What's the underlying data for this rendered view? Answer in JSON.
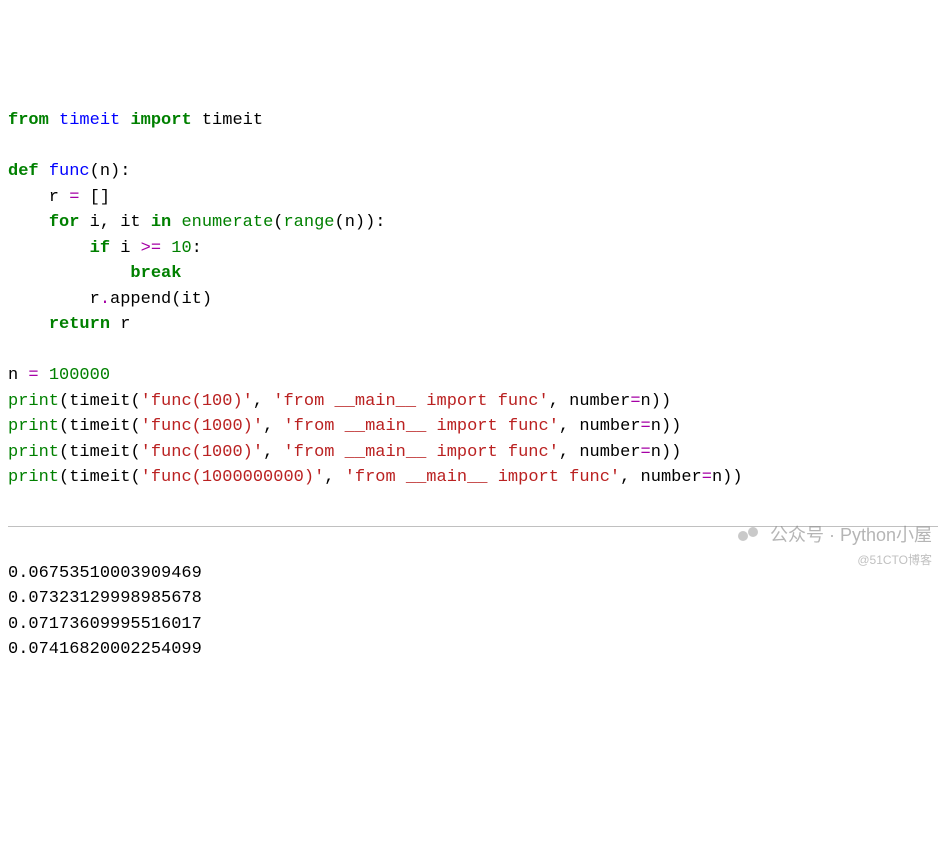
{
  "code": {
    "l1_from": "from",
    "l1_mod": "timeit",
    "l1_import": "import",
    "l1_name": "timeit",
    "l3_def": "def",
    "l3_func": "func",
    "l3_paren_open": "(",
    "l3_param": "n",
    "l3_paren_close_colon": "):",
    "l4_indent": "    r ",
    "l4_eq": "=",
    "l4_rest": " []",
    "l5_indent": "    ",
    "l5_for": "for",
    "l5_mid": " i, it ",
    "l5_in": "in",
    "l5_sp": " ",
    "l5_enum": "enumerate",
    "l5_po": "(",
    "l5_range": "range",
    "l5_args": "(n)):",
    "l6_indent": "        ",
    "l6_if": "if",
    "l6_mid": " i ",
    "l6_op": ">=",
    "l6_sp": " ",
    "l6_num": "10",
    "l6_colon": ":",
    "l7_indent": "            ",
    "l7_break": "break",
    "l8": "        r",
    "l8_dot": ".",
    "l8_append": "append(it)",
    "l9_indent": "    ",
    "l9_return": "return",
    "l9_r": " r",
    "l11": "n ",
    "l11_eq": "=",
    "l11_sp": " ",
    "l11_num": "100000",
    "print": "print",
    "popen": "(",
    "timeit": "timeit",
    "topen": "(",
    "s1_a": "'func(100)'",
    "s1_b": "'from __main__ import func'",
    "s2_a": "'func(1000)'",
    "s2_b": "'from __main__ import func'",
    "s3_a": "'func(1000)'",
    "s3_b": "'from __main__ import func'",
    "s4_a": "'func(1000000000)'",
    "s4_b": "'from __main__ import func'",
    "comma": ", ",
    "kw_number": "number",
    "eq": "=",
    "arg_n": "n",
    "close": "))"
  },
  "output": {
    "l1": "0.06753510003909469",
    "l2": "0.07323129998985678",
    "l3": "0.07173609995516017",
    "l4": "0.07416820002254099"
  },
  "watermark": {
    "top": "公众号 · Python小屋",
    "bottom": "@51CTO博客"
  }
}
